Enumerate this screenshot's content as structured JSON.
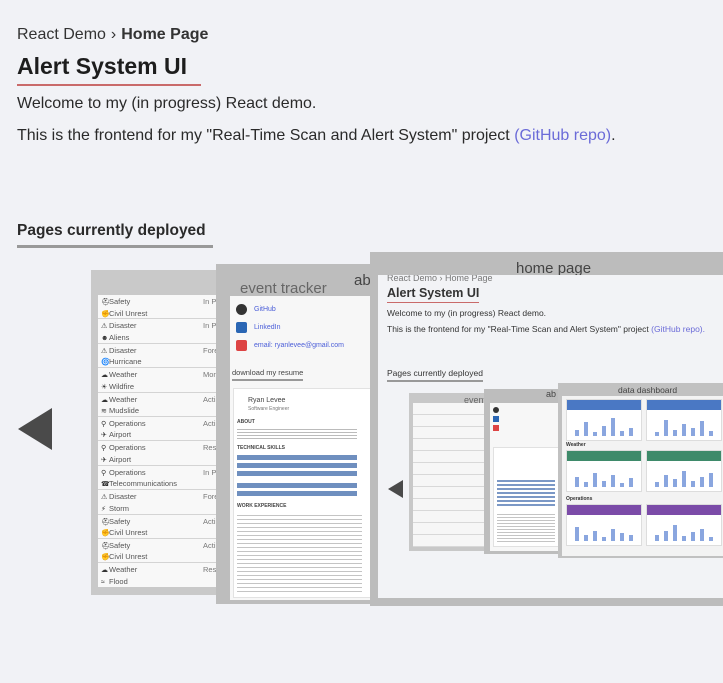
{
  "breadcrumb": {
    "root": "React Demo",
    "separator": "›",
    "current": "Home Page"
  },
  "page_title": "Alert System UI",
  "intro": "Welcome to my (in progress) React demo.",
  "description": {
    "text": "This is the frontend for my \"Real-Time Scan and Alert System\" project ",
    "link_label": "(GitHub repo)",
    "end": "."
  },
  "section_heading": "Pages currently deployed",
  "carousel": {
    "cards": [
      {
        "title": "",
        "alerts": [
          {
            "category": "Safety",
            "subtype": "Civil Unrest",
            "status": "In P"
          },
          {
            "category": "Disaster",
            "subtype": "Aliens",
            "status": "In P"
          },
          {
            "category": "Disaster",
            "subtype": "Hurricane",
            "status": "Fore"
          },
          {
            "category": "Weather",
            "subtype": "Wildfire",
            "status": "Mon"
          },
          {
            "category": "Weather",
            "subtype": "Mudslide",
            "status": "Acti"
          },
          {
            "category": "Operations",
            "subtype": "Airport",
            "status": "Acti"
          },
          {
            "category": "Operations",
            "subtype": "Airport",
            "status": "Rese"
          },
          {
            "category": "Operations",
            "subtype": "Telecommunications",
            "status": "In P"
          },
          {
            "category": "Disaster",
            "subtype": "Storm",
            "status": "Fore"
          },
          {
            "category": "Safety",
            "subtype": "Civil Unrest",
            "status": "Acti"
          },
          {
            "category": "Safety",
            "subtype": "Civil Unrest",
            "status": "Acti"
          },
          {
            "category": "Weather",
            "subtype": "Flood",
            "status": "Rese"
          }
        ]
      },
      {
        "title": "event tracker",
        "links": {
          "github": "GitHub",
          "linkedin": "LinkedIn",
          "email": "email: ryanlevee@gmail.com"
        },
        "download": "download my resume",
        "name": "Ryan Levee",
        "role": "Software Engineer",
        "about": "ABOUT",
        "skills": "TECHNICAL SKILLS",
        "experience": "WORK EXPERIENCE"
      },
      {
        "title": "about",
        "short_title": "ab"
      },
      {
        "title": "home page",
        "breadcrumb": "React Demo › Home Page",
        "page_title": "Alert System UI",
        "intro": "Welcome to my (in progress) React demo.",
        "description": "This is the frontend for my \"Real-Time Scan and Alert System\" project ",
        "link_label": "(GitHub repo).",
        "section_heading": "Pages currently deployed",
        "nested_titles": {
          "tracker": "event tracker",
          "about": "ab",
          "dashboard": "data dashboard"
        },
        "dashboard_sections": {
          "weather": "Weather",
          "operations": "Operations"
        }
      }
    ]
  },
  "colors": {
    "link": "#6b6bd8",
    "title_underline": "#c96a6a",
    "dash_green": "#3e8a6a",
    "dash_purple": "#7b4ba8",
    "dash_blue": "#4a78c4"
  }
}
